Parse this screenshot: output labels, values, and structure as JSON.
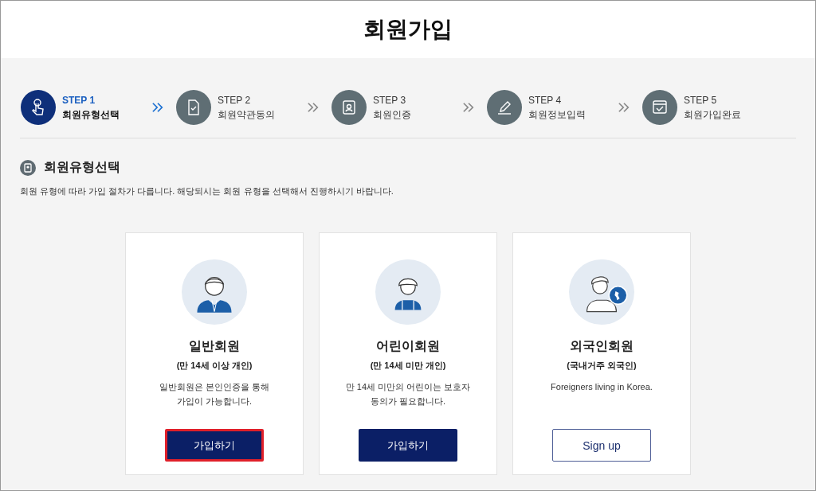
{
  "page_title": "회원가입",
  "steps": [
    {
      "step": "STEP 1",
      "label": "회원유형선택",
      "kind": "hand",
      "selected": true
    },
    {
      "step": "STEP 2",
      "label": "회원약관동의",
      "kind": "document",
      "selected": false
    },
    {
      "step": "STEP 3",
      "label": "회원인증",
      "kind": "badge",
      "selected": false
    },
    {
      "step": "STEP 4",
      "label": "회원정보입력",
      "kind": "pen",
      "selected": false
    },
    {
      "step": "STEP 5",
      "label": "회원가입완료",
      "kind": "calendar",
      "selected": false
    }
  ],
  "section": {
    "title": "회원유형선택",
    "description": "회원 유형에 따라 가입 절차가 다릅니다. 해당되시는 회원 유형을 선택해서 진행하시기 바랍니다."
  },
  "cards": [
    {
      "kind": "adult",
      "title": "일반회원",
      "subtitle": "(만 14세 이상 개인)",
      "description": [
        "일반회원은 본인인증을 통해",
        "가입이 가능합니다."
      ],
      "button": {
        "label": "가입하기",
        "kind": "filled",
        "highlighted": true
      }
    },
    {
      "kind": "child",
      "title": "어린이회원",
      "subtitle": "(만 14세 미만 개인)",
      "description": [
        "만 14세 미만의 어린이는 보호자",
        "동의가 필요합니다."
      ],
      "button": {
        "label": "가입하기",
        "kind": "filled",
        "highlighted": false
      }
    },
    {
      "kind": "foreigner",
      "title": "외국인회원",
      "subtitle": "(국내거주 외국인)",
      "description": [
        "Foreigners living in Korea."
      ],
      "button": {
        "label": "Sign up",
        "kind": "outline",
        "highlighted": false
      }
    }
  ]
}
